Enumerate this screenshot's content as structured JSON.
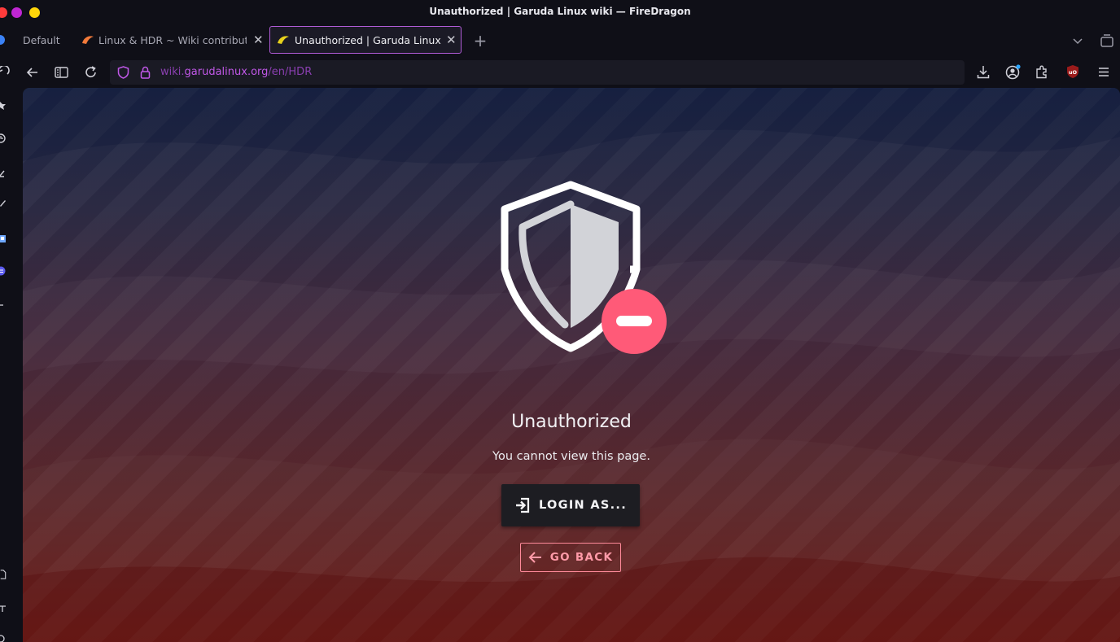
{
  "window": {
    "title": "Unauthorized | Garuda Linux wiki — FireDragon"
  },
  "tabs": [
    {
      "label": "Default"
    },
    {
      "label": "Linux & HDR ~ Wiki contributio"
    },
    {
      "label": "Unauthorized | Garuda Linux w"
    }
  ],
  "address": {
    "domain_prefix": "wiki.",
    "domain": "garudalinux.org",
    "path": "/en/HDR"
  },
  "page": {
    "title": "Unauthorized",
    "message": "You cannot view this page.",
    "login_label": "LOGIN AS...",
    "back_label": "GO BACK"
  },
  "colors": {
    "accent": "#b05bd6",
    "deny_badge": "#ff5a78",
    "back_outline": "#ff8a9a"
  }
}
